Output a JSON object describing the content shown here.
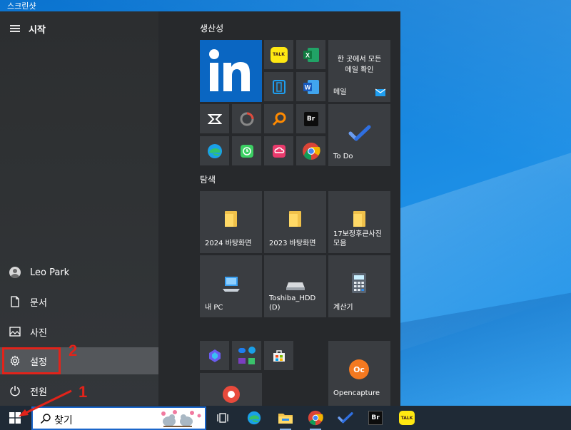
{
  "caption": "스크린샷",
  "start_menu": {
    "title": "시작",
    "rail": {
      "user": "Leo Park",
      "documents": "문서",
      "pictures": "사진",
      "settings": "설정",
      "power": "전원"
    }
  },
  "tiles": {
    "productivity": {
      "label": "생산성",
      "mail_top": "한 곳에서 모든 메일 확인",
      "mail_label": "메일",
      "todo_label": "To Do",
      "kakaotalk_text": "TALK",
      "bridge_text": "Br"
    },
    "explore": {
      "label": "탐색",
      "folder1": "2024 바탕화면",
      "folder2": "2023 바탕화면",
      "folder3": "17보정후큰사진모음",
      "pc": "내 PC",
      "drive": "Toshiba_HDD (D)",
      "calc": "계산기"
    },
    "bottom": {
      "opencapture": "Opencapture",
      "opencapture_text": "Oc"
    }
  },
  "taskbar": {
    "search_text": "찾기",
    "bridge_text": "Br",
    "talk_text": "TALK"
  },
  "annotations": {
    "one": "1",
    "two": "2"
  },
  "colors": {
    "accent_red": "#e2231a",
    "linkedin": "#0a66c2",
    "desktop_blue": "#0b73cf",
    "taskbar": "#1f2a36"
  }
}
